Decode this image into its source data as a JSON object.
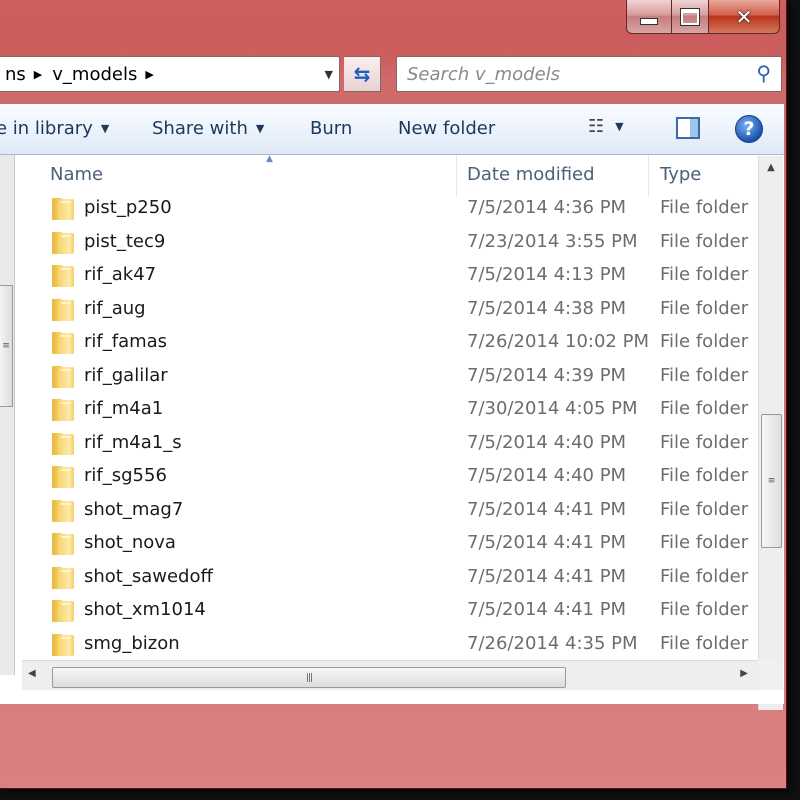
{
  "window": {
    "close_glyph": "✕"
  },
  "address": {
    "crumbs": [
      "ns",
      "v_models"
    ]
  },
  "search": {
    "placeholder": "Search v_models"
  },
  "toolbar": {
    "include_library": "e in library",
    "share_with": "Share with",
    "burn": "Burn",
    "new_folder": "New folder",
    "help_glyph": "?"
  },
  "list": {
    "columns": {
      "name": "Name",
      "date": "Date modified",
      "type": "Type"
    },
    "rows": [
      {
        "name": "pist_p250",
        "date": "7/5/2014 4:36 PM",
        "type": "File folder"
      },
      {
        "name": "pist_tec9",
        "date": "7/23/2014 3:55 PM",
        "type": "File folder"
      },
      {
        "name": "rif_ak47",
        "date": "7/5/2014 4:13 PM",
        "type": "File folder"
      },
      {
        "name": "rif_aug",
        "date": "7/5/2014 4:38 PM",
        "type": "File folder"
      },
      {
        "name": "rif_famas",
        "date": "7/26/2014 10:02 PM",
        "type": "File folder"
      },
      {
        "name": "rif_galilar",
        "date": "7/5/2014 4:39 PM",
        "type": "File folder"
      },
      {
        "name": "rif_m4a1",
        "date": "7/30/2014 4:05 PM",
        "type": "File folder"
      },
      {
        "name": "rif_m4a1_s",
        "date": "7/5/2014 4:40 PM",
        "type": "File folder"
      },
      {
        "name": "rif_sg556",
        "date": "7/5/2014 4:40 PM",
        "type": "File folder"
      },
      {
        "name": "shot_mag7",
        "date": "7/5/2014 4:41 PM",
        "type": "File folder"
      },
      {
        "name": "shot_nova",
        "date": "7/5/2014 4:41 PM",
        "type": "File folder"
      },
      {
        "name": "shot_sawedoff",
        "date": "7/5/2014 4:41 PM",
        "type": "File folder"
      },
      {
        "name": "shot_xm1014",
        "date": "7/5/2014 4:41 PM",
        "type": "File folder"
      },
      {
        "name": "smg_bizon",
        "date": "7/26/2014 4:35 PM",
        "type": "File folder"
      }
    ]
  },
  "icons": {
    "folder": "folder-icon",
    "search": "magnifier-icon",
    "refresh": "refresh-icon",
    "views": "view-details-icon",
    "preview_pane": "preview-pane-icon",
    "help": "help-icon"
  },
  "colors": {
    "frame": "#cf6a6a",
    "toolbar_text": "#1e395b",
    "header_text": "#4c607a",
    "secondary_text": "#6d6d6d"
  }
}
